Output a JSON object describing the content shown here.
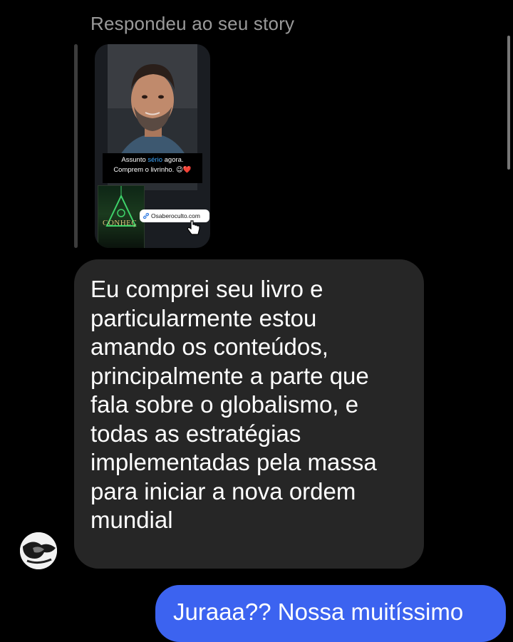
{
  "reply_label": "Respondeu ao seu story",
  "story": {
    "caption_prefix": "Assunto ",
    "caption_highlight": "sério",
    "caption_suffix": " agora.",
    "caption_line2": "Comprem o livrinho. 😉❤️",
    "book_title": "CONHEÇ",
    "link_sticker_text": "Osaberoculto.com"
  },
  "incoming_message": {
    "text": "Eu comprei seu livro e\nparticularmente estou\namando os conteúdos,\nprincipalmente a parte que\nfala sobre o globalismo, e\ntodas as estratégias\nimplementadas pela massa\npara iniciar a nova ordem\nmundial"
  },
  "outgoing_message": {
    "text": "Juraaa?? Nossa muitíssimo"
  },
  "colors": {
    "background": "#000000",
    "incoming_bubble": "#262626",
    "outgoing_bubble": "#3c63f0",
    "reply_label": "#9a9a9a"
  }
}
